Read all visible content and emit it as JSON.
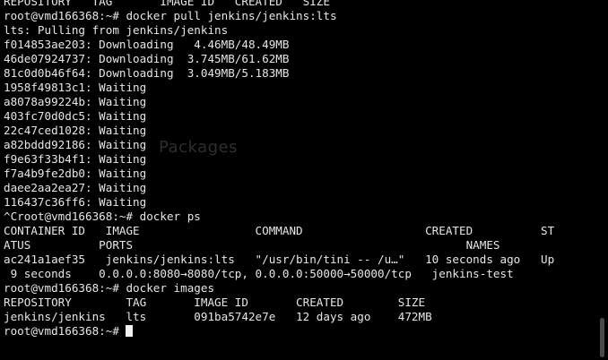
{
  "terminal": {
    "background_label": "Packages",
    "lines": [
      "REPOSITORY   TAG       IMAGE ID   CREATED   SIZE",
      "root@vmd166368:~# docker pull jenkins/jenkins:lts",
      "lts: Pulling from jenkins/jenkins",
      "f014853ae203: Downloading   4.46MB/48.49MB",
      "46de07924737: Downloading  3.745MB/61.62MB",
      "81c0d0b46f64: Downloading  3.049MB/5.183MB",
      "1958f49813c1: Waiting",
      "a8078a99224b: Waiting",
      "403fc70d0dc5: Waiting",
      "22c47ced1028: Waiting",
      "a82bddd92186: Waiting",
      "f9e63f33b4f1: Waiting",
      "f7a4b9fe2db0: Waiting",
      "daee2aa2ea27: Waiting",
      "116437c36ff6: Waiting",
      "^Croot@vmd166368:~# docker ps",
      "CONTAINER ID   IMAGE                 COMMAND                  CREATED          ST",
      "ATUS          PORTS                                                 NAMES",
      "ac241a1aef35   jenkins/jenkins:lts   \"/usr/bin/tini -- /u…\"   10 seconds ago   Up",
      " 9 seconds    0.0.0.0:8080→8080/tcp, 0.0.0.0:50000→50000/tcp   jenkins-test",
      "root@vmd166368:~# docker images",
      "REPOSITORY        TAG       IMAGE ID       CREATED        SIZE",
      "jenkins/jenkins   lts       091ba5742e7e   12 days ago    472MB"
    ],
    "prompt": "root@vmd166368:~# "
  }
}
